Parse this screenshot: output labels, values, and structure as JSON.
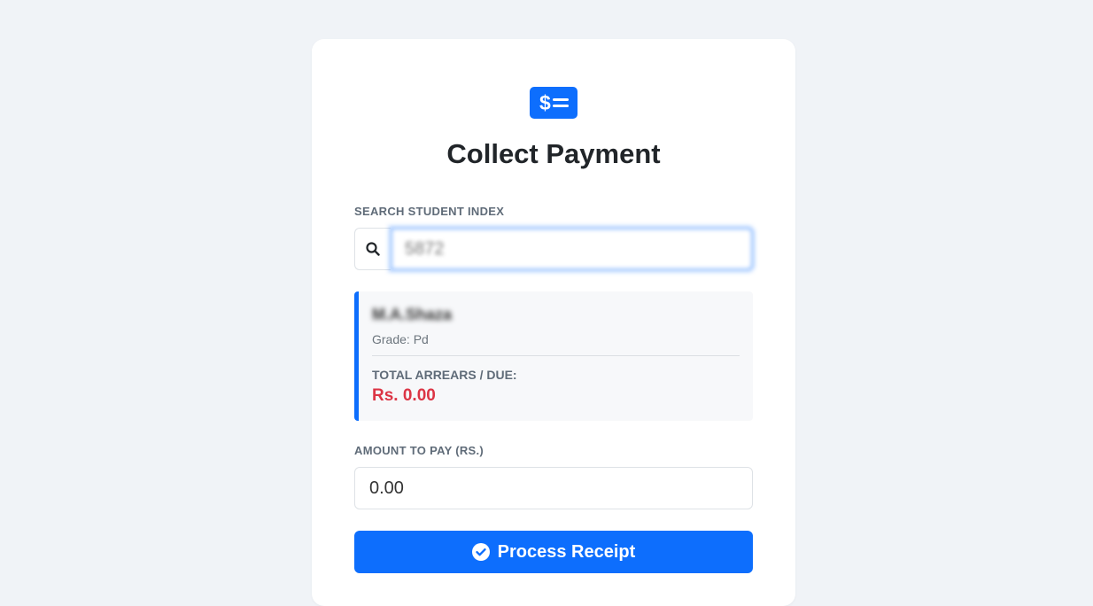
{
  "header": {
    "icon": "cash-payment-icon",
    "title": "Collect Payment"
  },
  "search": {
    "label": "SEARCH STUDENT INDEX",
    "icon": "search-icon",
    "value": "5872"
  },
  "student": {
    "name": "M.A.Shaza",
    "grade": "Grade: Pd",
    "arrears_label": "TOTAL ARREARS / DUE:",
    "arrears_value": "Rs. 0.00"
  },
  "amount": {
    "label": "AMOUNT TO PAY (RS.)",
    "value": "0.00"
  },
  "submit": {
    "icon": "check-circle-icon",
    "label": "Process Receipt"
  },
  "colors": {
    "accent": "#0d6efd",
    "danger": "#dc3545",
    "background": "#f0f3f7"
  }
}
